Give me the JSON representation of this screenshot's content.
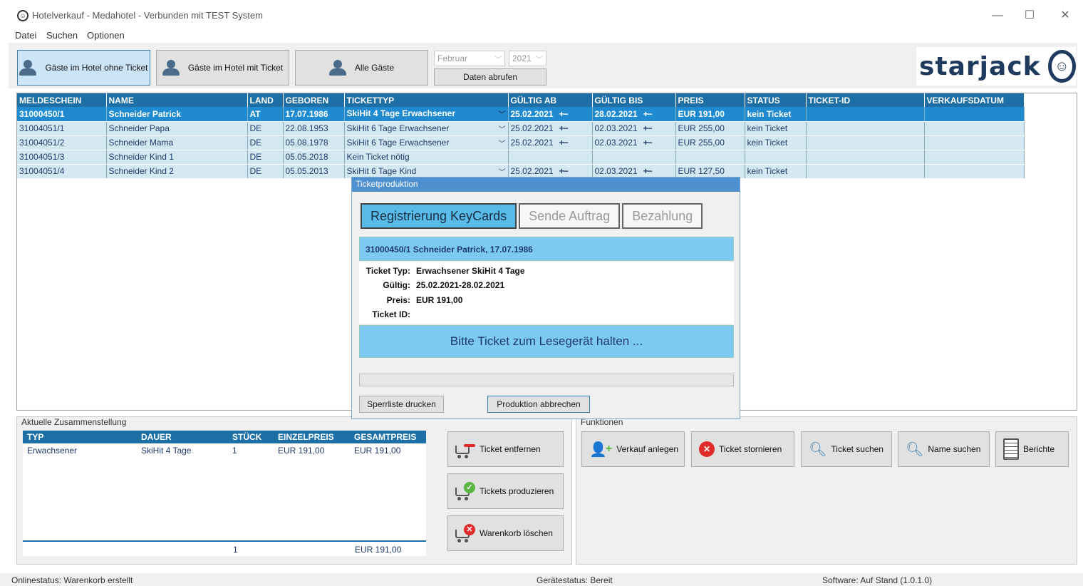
{
  "window": {
    "title": "Hotelverkauf - Medahotel - Verbunden mit TEST System",
    "minimize": "—",
    "maximize": "☐",
    "close": "✕"
  },
  "menu": [
    "Datei",
    "Suchen",
    "Optionen"
  ],
  "toolbar": {
    "btn_without_ticket": "Gäste im Hotel ohne Ticket",
    "btn_with_ticket": "Gäste im Hotel mit Ticket",
    "btn_all": "Alle Gäste",
    "month": "Februar",
    "year": "2021",
    "fetch": "Daten abrufen"
  },
  "logo": {
    "text": "starjack",
    "mark": "☺"
  },
  "table": {
    "headers": [
      "MELDESCHEIN",
      "NAME",
      "LAND",
      "GEBOREN",
      "TICKETTYP",
      "GÜLTIG AB",
      "GÜLTIG BIS",
      "PREIS",
      "STATUS",
      "TICKET-ID",
      "VERKAUFSDATUM"
    ],
    "rows": [
      {
        "meldeschein": "31000450/1",
        "name": "Schneider Patrick",
        "land": "AT",
        "geboren": "17.07.1986",
        "tickettyp": "SkiHit 4 Tage Erwachsener",
        "ab": "25.02.2021",
        "bis": "28.02.2021",
        "preis": "EUR 191,00",
        "status": "kein Ticket"
      },
      {
        "meldeschein": "31004051/1",
        "name": "Schneider Papa",
        "land": "DE",
        "geboren": "22.08.1953",
        "tickettyp": "SkiHit 6 Tage Erwachsener",
        "ab": "25.02.2021",
        "bis": "02.03.2021",
        "preis": "EUR 255,00",
        "status": "kein Ticket"
      },
      {
        "meldeschein": "31004051/2",
        "name": "Schneider Mama",
        "land": "DE",
        "geboren": "05.08.1978",
        "tickettyp": "SkiHit 6 Tage Erwachsener",
        "ab": "25.02.2021",
        "bis": "02.03.2021",
        "preis": "EUR 255,00",
        "status": "kein Ticket"
      },
      {
        "meldeschein": "31004051/3",
        "name": "Schneider Kind 1",
        "land": "DE",
        "geboren": "05.05.2018",
        "tickettyp": "Kein Ticket nötig",
        "ab": "",
        "bis": "",
        "preis": "",
        "status": ""
      },
      {
        "meldeschein": "31004051/4",
        "name": "Schneider Kind 2",
        "land": "DE",
        "geboren": "05.05.2013",
        "tickettyp": "SkiHit 6 Tage Kind",
        "ab": "25.02.2021",
        "bis": "02.03.2021",
        "preis": "EUR 127,50",
        "status": "kein Ticket"
      }
    ]
  },
  "cart": {
    "title": "Aktuelle Zusammenstellung",
    "headers": [
      "TYP",
      "DAUER",
      "STÜCK",
      "EINZELPREIS",
      "GESAMTPREIS"
    ],
    "rows": [
      {
        "typ": "Erwachsener",
        "dauer": "SkiHit 4 Tage",
        "stueck": "1",
        "einzel": "EUR 191,00",
        "gesamt": "EUR 191,00"
      }
    ],
    "total_count": "1",
    "total_price": "EUR 191,00",
    "btn_remove": "Ticket entfernen",
    "btn_produce": "Tickets produzieren",
    "btn_clear": "Warenkorb löschen"
  },
  "functions": {
    "title": "Funktionen",
    "create_sale": "Verkauf anlegen",
    "cancel_ticket": "Ticket stornieren",
    "find_ticket": "Ticket suchen",
    "find_name": "Name suchen",
    "reports": "Berichte"
  },
  "dialog": {
    "title": "Ticketproduktion",
    "steps": [
      "Registrierung KeyCards",
      "Sende Auftrag",
      "Bezahlung"
    ],
    "guest": "31000450/1 Schneider Patrick, 17.07.1986",
    "lbl_type": "Ticket Typ:",
    "val_type": "Erwachsener SkiHit 4 Tage",
    "lbl_valid": "Gültig:",
    "val_valid": "25.02.2021-28.02.2021",
    "lbl_price": "Preis:",
    "val_price": "EUR 191,00",
    "lbl_id": "Ticket ID:",
    "hold_msg": "Bitte Ticket zum Lesegerät halten ...",
    "btn_blocklist": "Sperrliste drucken",
    "btn_abort": "Produktion abbrechen"
  },
  "status": {
    "online": "Onlinestatus: Warenkorb erstellt",
    "device": "Gerätestatus: Bereit",
    "software": "Software: Auf Stand (1.0.1.0)"
  },
  "colors": {
    "header_blue": "#1d6fa5",
    "selected_row": "#1f8ad0",
    "row_bg": "#d4e8f2",
    "dialog_accent": "#7ccaf0",
    "danger": "#e02b2b",
    "success": "#5bb543"
  }
}
